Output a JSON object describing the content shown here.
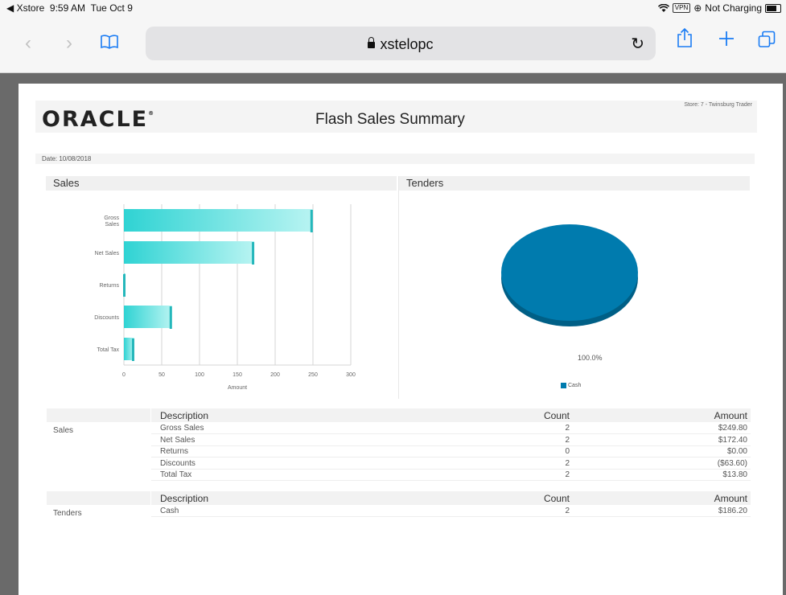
{
  "status_bar": {
    "app": "Xstore",
    "time": "9:59 AM",
    "date": "Tue Oct 9",
    "vpn": "VPN",
    "charging": "Not Charging"
  },
  "browser": {
    "url": "xstelopc"
  },
  "report": {
    "logo": "ORACLE",
    "title": "Flash Sales Summary",
    "store": "Store: 7 - Twinsburg Trader",
    "date": "Date: 10/08/2018",
    "sales_header": "Sales",
    "tenders_header": "Tenders"
  },
  "chart_data": [
    {
      "type": "bar",
      "orientation": "horizontal",
      "title": "Sales",
      "categories": [
        "Gross Sales",
        "Net Sales",
        "Returns",
        "Discounts",
        "Total Tax"
      ],
      "values": [
        249.8,
        172.4,
        0,
        63.6,
        13.8
      ],
      "xlabel": "Amount",
      "xlim": [
        0,
        300
      ],
      "xticks": [
        "0",
        "50",
        "100",
        "150",
        "200",
        "250",
        "300"
      ],
      "grid": true,
      "color": "#3ed8d8"
    },
    {
      "type": "pie",
      "title": "Tenders",
      "categories": [
        "Cash"
      ],
      "values": [
        100.0
      ],
      "label": "100.0%",
      "legend": "bottom",
      "color": "#007bae"
    }
  ],
  "sales_table": {
    "section_label": "Sales",
    "headers": {
      "description": "Description",
      "count": "Count",
      "amount": "Amount"
    },
    "rows": [
      {
        "description": "Gross Sales",
        "count": "2",
        "amount": "$249.80"
      },
      {
        "description": "Net Sales",
        "count": "2",
        "amount": "$172.40"
      },
      {
        "description": "Returns",
        "count": "0",
        "amount": "$0.00"
      },
      {
        "description": "Discounts",
        "count": "2",
        "amount": "($63.60)"
      },
      {
        "description": "Total Tax",
        "count": "2",
        "amount": "$13.80"
      }
    ]
  },
  "tenders_table": {
    "section_label": "Tenders",
    "headers": {
      "description": "Description",
      "count": "Count",
      "amount": "Amount"
    },
    "rows": [
      {
        "description": "Cash",
        "count": "2",
        "amount": "$186.20"
      }
    ]
  }
}
